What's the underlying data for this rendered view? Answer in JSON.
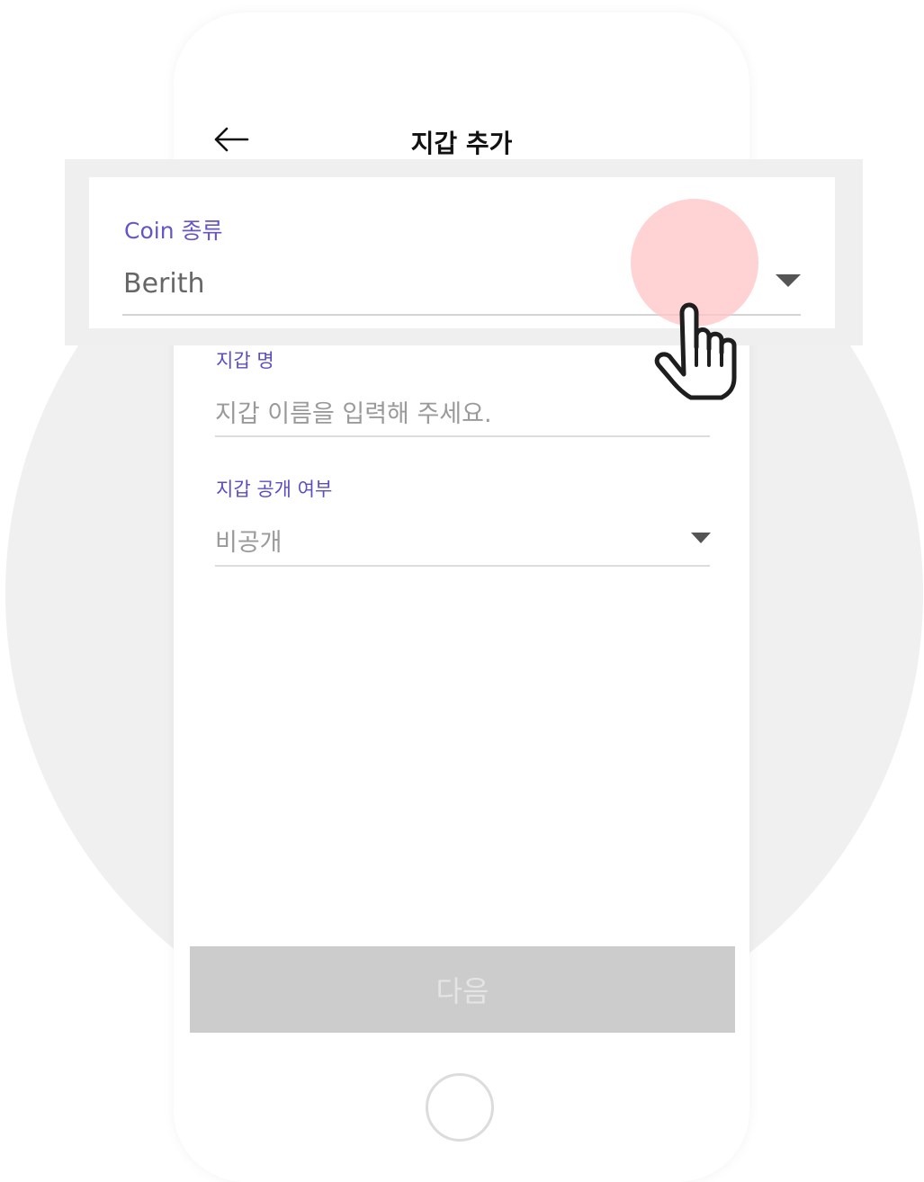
{
  "header": {
    "title": "지갑 추가",
    "back_icon": "arrow-left-icon"
  },
  "coin_type": {
    "label": "Coin 종류",
    "value": "Berith",
    "dropdown_icon": "caret-down-icon"
  },
  "wallet_name": {
    "label": "지갑 명",
    "placeholder": "지갑 이름을 입력해 주세요."
  },
  "wallet_visibility": {
    "label": "지갑 공개 여부",
    "value": "비공개",
    "dropdown_icon": "caret-down-icon"
  },
  "footer": {
    "next_label": "다음"
  },
  "colors": {
    "accent": "#5b4ec2",
    "tap_indicator": "#ffc4c6",
    "disabled_button": "#cccccc",
    "backdrop_circle": "#f0f0f0"
  },
  "overlay": {
    "tap_icon": "pointing-hand-icon"
  }
}
